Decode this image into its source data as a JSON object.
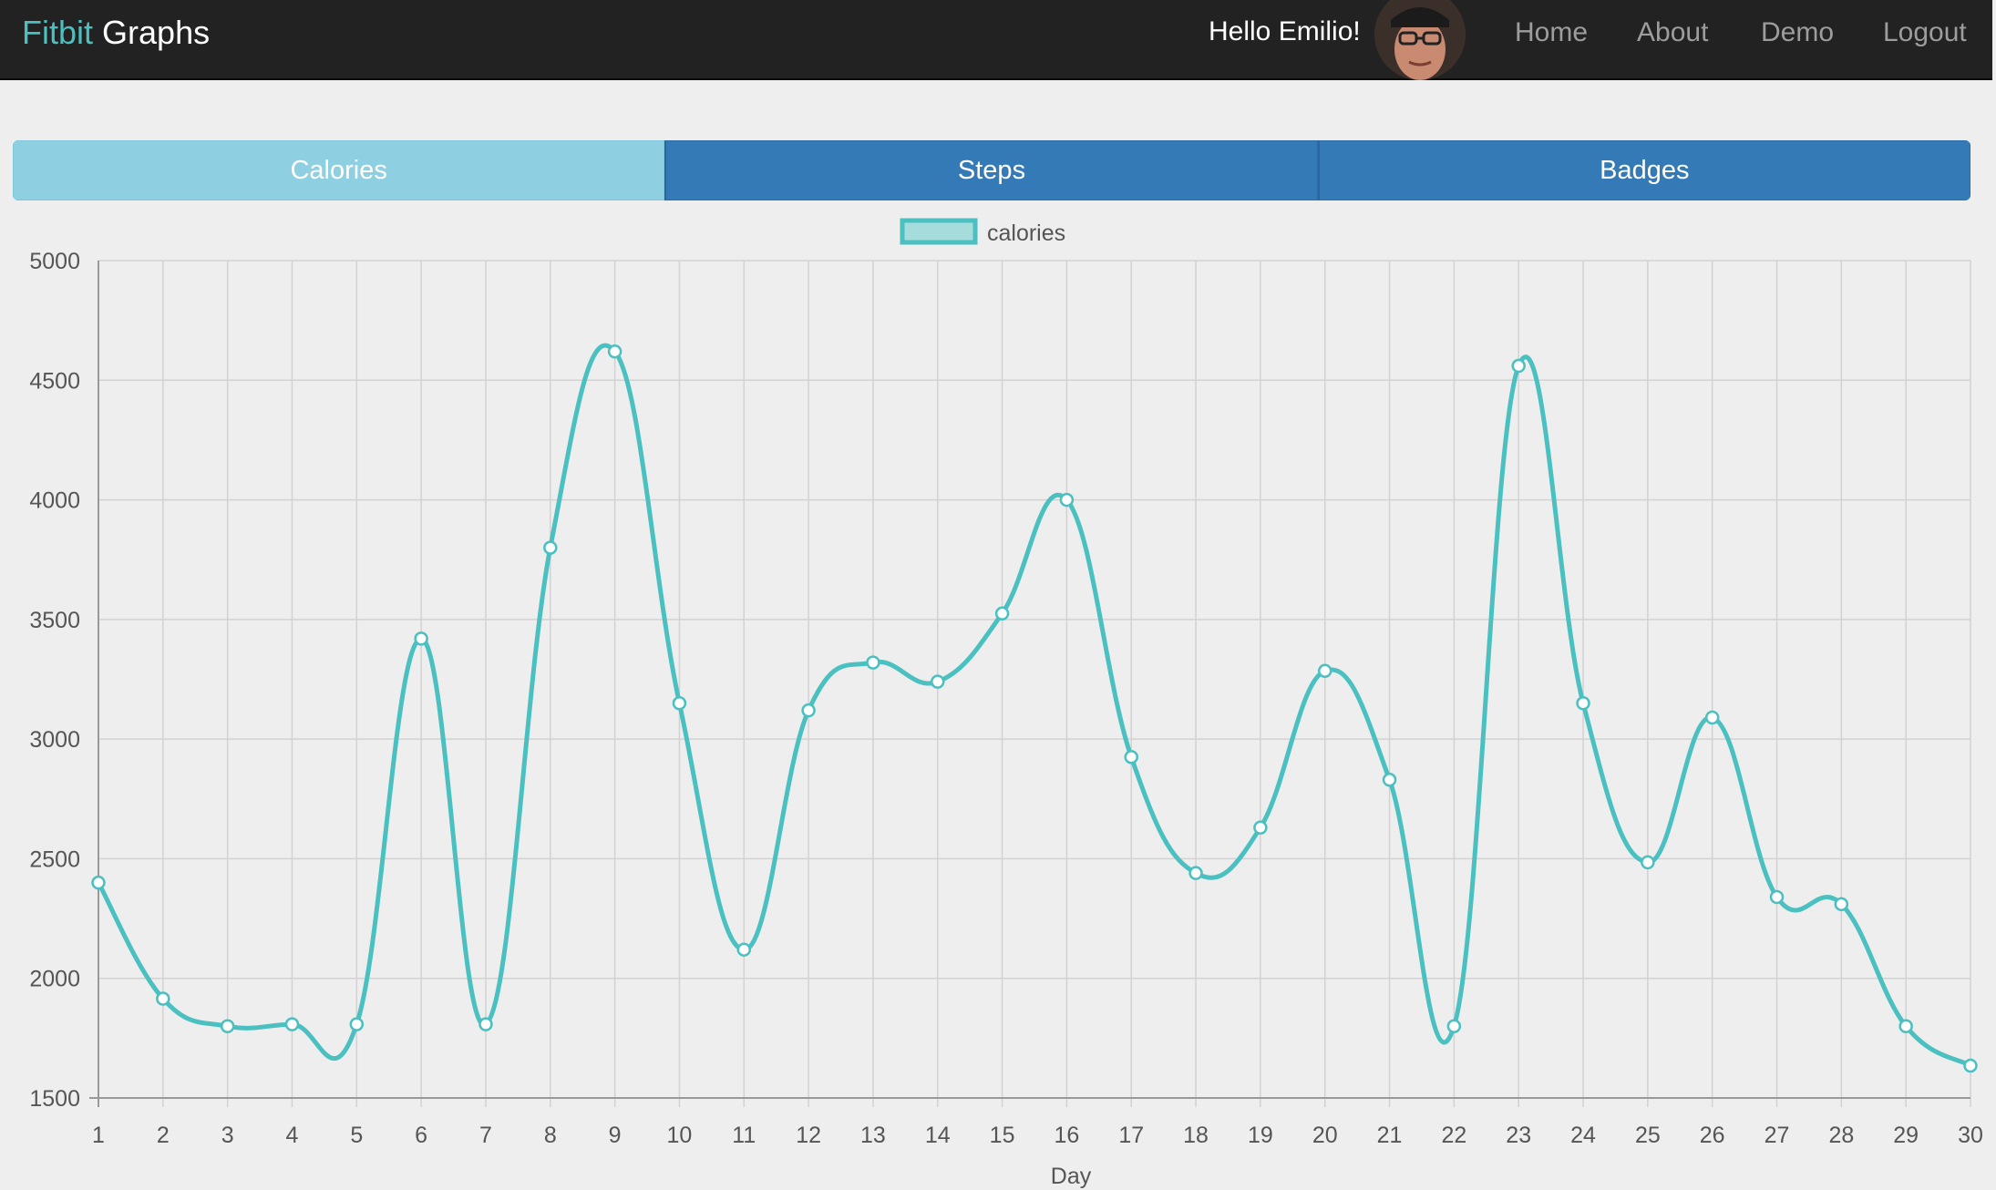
{
  "navbar": {
    "brand_part1": "Fitbit",
    "brand_part2": "Graphs",
    "greeting": "Hello Emilio!",
    "links": [
      "Home",
      "About",
      "Demo",
      "Logout"
    ]
  },
  "tabs": [
    {
      "label": "Calories",
      "active": true
    },
    {
      "label": "Steps",
      "active": false
    },
    {
      "label": "Badges",
      "active": false
    }
  ],
  "colors": {
    "navbar_bg": "#222222",
    "brand_accent": "#4bc0c0",
    "tab_active": "#8ed0e2",
    "tab_inactive": "#337ab7",
    "series_line": "#4bc0c0",
    "series_fill": "#a7dcdc"
  },
  "chart_data": {
    "type": "line",
    "xlabel": "Day",
    "ylabel": "",
    "categories": [
      "1",
      "2",
      "3",
      "4",
      "5",
      "6",
      "7",
      "8",
      "9",
      "10",
      "11",
      "12",
      "13",
      "14",
      "15",
      "16",
      "17",
      "18",
      "19",
      "20",
      "21",
      "22",
      "23",
      "24",
      "25",
      "26",
      "27",
      "28",
      "29",
      "30"
    ],
    "series": [
      {
        "name": "calories",
        "values": [
          2400,
          1915,
          1800,
          1808,
          1808,
          3420,
          1808,
          3800,
          4620,
          3150,
          2120,
          3120,
          3320,
          3240,
          3525,
          4000,
          2925,
          2440,
          2630,
          3285,
          2830,
          1800,
          4560,
          3150,
          2485,
          3090,
          2340,
          2310,
          1800,
          1635
        ]
      }
    ],
    "ylim": [
      1500,
      5000
    ],
    "yticks": [
      1500,
      2000,
      2500,
      3000,
      3500,
      4000,
      4500,
      5000
    ],
    "grid": true,
    "legend_position": "top"
  }
}
